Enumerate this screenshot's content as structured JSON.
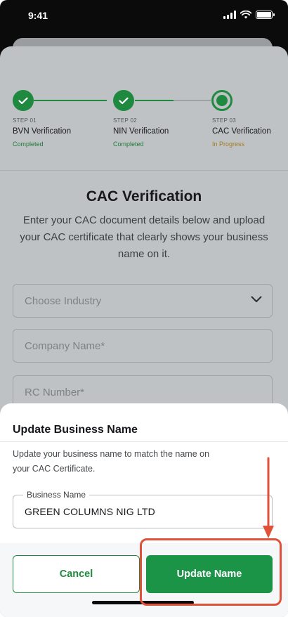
{
  "status_bar": {
    "time": "9:41"
  },
  "stepper": {
    "steps": [
      {
        "number": "STEP 01",
        "title": "BVN Verification",
        "status": "Completed",
        "state": "completed"
      },
      {
        "number": "STEP 02",
        "title": "NIN Verification",
        "status": "Completed",
        "state": "completed"
      },
      {
        "number": "STEP 03",
        "title": "CAC Verification",
        "status": "In Progress",
        "state": "in-progress"
      }
    ]
  },
  "cac": {
    "title": "CAC Verification",
    "description": "Enter your CAC document details below and upload your CAC certificate that clearly shows your business name on it.",
    "industry_placeholder": "Choose Industry",
    "company_name_placeholder": "Company Name*",
    "rc_number_placeholder": "RC Number*"
  },
  "modal": {
    "title": "Update Business Name",
    "description": "Update your business name to match the name on your CAC Certificate.",
    "field_label": "Business Name",
    "field_value": "GREEN COLUMNS NIG LTD",
    "cancel_label": "Cancel",
    "update_label": "Update Name"
  },
  "colors": {
    "primary_green": "#1c9447",
    "in_progress": "#a27b22",
    "annotation_red": "#e0513a"
  },
  "icons": [
    "check-icon",
    "chevron-down-icon",
    "wifi-icon",
    "battery-icon",
    "signal-icon"
  ]
}
